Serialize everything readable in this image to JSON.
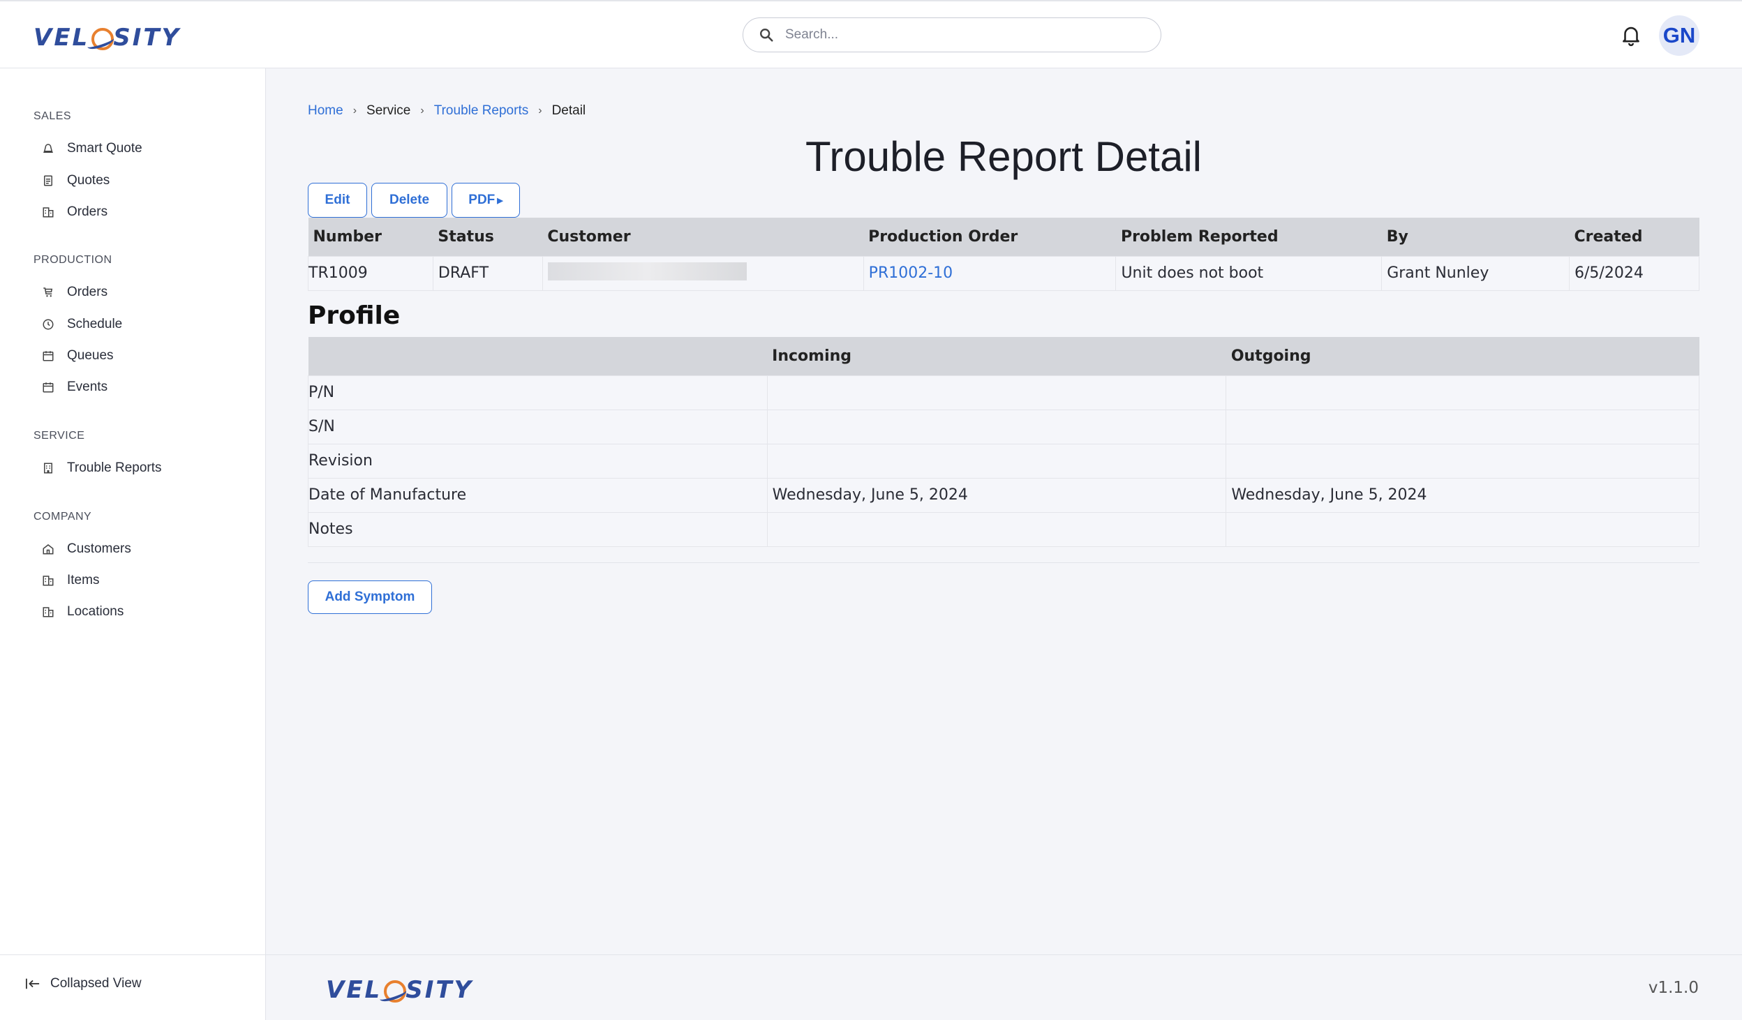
{
  "brand": {
    "name_pre": "VEL",
    "name_post": "SITY",
    "accent": "#e8802e",
    "primary": "#2f4d9c"
  },
  "header": {
    "search_placeholder": "Search...",
    "user_initials": "GN"
  },
  "sidebar": {
    "sections": [
      {
        "title": "SALES",
        "items": [
          {
            "label": "Smart Quote",
            "icon": "bell-outline-icon"
          },
          {
            "label": "Quotes",
            "icon": "document-icon"
          },
          {
            "label": "Orders",
            "icon": "building-icon"
          }
        ]
      },
      {
        "title": "PRODUCTION",
        "items": [
          {
            "label": "Orders",
            "icon": "cart-icon"
          },
          {
            "label": "Schedule",
            "icon": "clock-icon"
          },
          {
            "label": "Queues",
            "icon": "calendar-icon"
          },
          {
            "label": "Events",
            "icon": "calendar-icon"
          }
        ]
      },
      {
        "title": "SERVICE",
        "items": [
          {
            "label": "Trouble Reports",
            "icon": "office-icon"
          }
        ]
      },
      {
        "title": "COMPANY",
        "items": [
          {
            "label": "Customers",
            "icon": "home-icon"
          },
          {
            "label": "Items",
            "icon": "building-icon"
          },
          {
            "label": "Locations",
            "icon": "building-icon"
          }
        ]
      }
    ],
    "collapse_label": "Collapsed View"
  },
  "breadcrumb": {
    "home": "Home",
    "service": "Service",
    "trouble_reports": "Trouble Reports",
    "detail": "Detail"
  },
  "page_title": "Trouble Report Detail",
  "actions": {
    "edit": "Edit",
    "delete": "Delete",
    "pdf": "PDF"
  },
  "report_table": {
    "headers": [
      "Number",
      "Status",
      "Customer",
      "Production Order",
      "Problem Reported",
      "By",
      "Created"
    ],
    "row": {
      "number": "TR1009",
      "status": "DRAFT",
      "production_order": "PR1002-10",
      "problem": "Unit does not boot",
      "by": "Grant Nunley",
      "created": "6/5/2024"
    }
  },
  "profile": {
    "title": "Profile",
    "headers": [
      "",
      "Incoming",
      "Outgoing"
    ],
    "rows": [
      {
        "label": "P/N",
        "incoming": "",
        "outgoing": ""
      },
      {
        "label": "S/N",
        "incoming": "",
        "outgoing": ""
      },
      {
        "label": "Revision",
        "incoming": "",
        "outgoing": ""
      },
      {
        "label": "Date of Manufacture",
        "incoming": "Wednesday, June 5, 2024",
        "outgoing": "Wednesday, June 5, 2024"
      },
      {
        "label": "Notes",
        "incoming": "",
        "outgoing": ""
      }
    ]
  },
  "add_symptom": "Add Symptom",
  "footer": {
    "version": "v1.1.0"
  }
}
